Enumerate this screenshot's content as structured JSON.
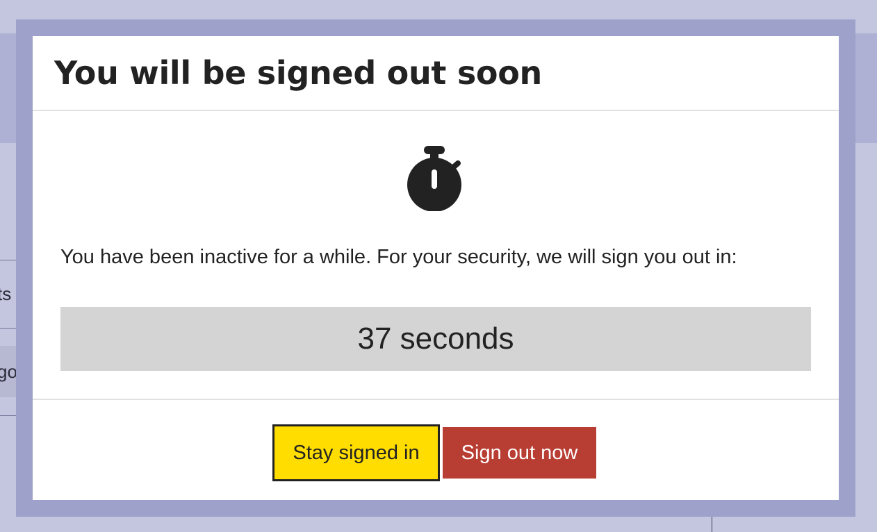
{
  "background": {
    "fragment_1": "ts",
    "fragment_2": "gor"
  },
  "dialog": {
    "title": "You will be signed out soon",
    "icon": "stopwatch-icon",
    "message": "You have been inactive for a while. For your security, we will sign you out in:",
    "countdown": "37 seconds",
    "buttons": {
      "stay": "Stay signed in",
      "signout": "Sign out now"
    }
  },
  "colors": {
    "overlay": "#c4c6df",
    "stay_button": "#ffdd00",
    "signout_button": "#b83d33",
    "countdown_bg": "#d4d4d4",
    "text": "#222222"
  }
}
